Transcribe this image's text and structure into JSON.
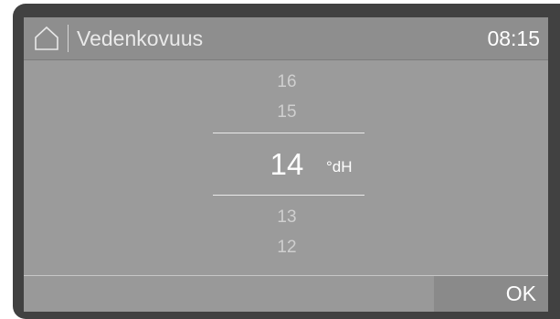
{
  "header": {
    "home_icon": "home-icon",
    "title": "Vedenkovuus",
    "time": "08:15"
  },
  "picker": {
    "values_above": [
      "16",
      "15"
    ],
    "selected_value": "14",
    "unit": "°dH",
    "values_below": [
      "13",
      "12"
    ]
  },
  "footer": {
    "ok_label": "OK"
  },
  "colors": {
    "bezel": "#414141",
    "screen": "#9b9b9b",
    "header": "#8e8e8e",
    "ok_button": "#8a8a8a"
  }
}
